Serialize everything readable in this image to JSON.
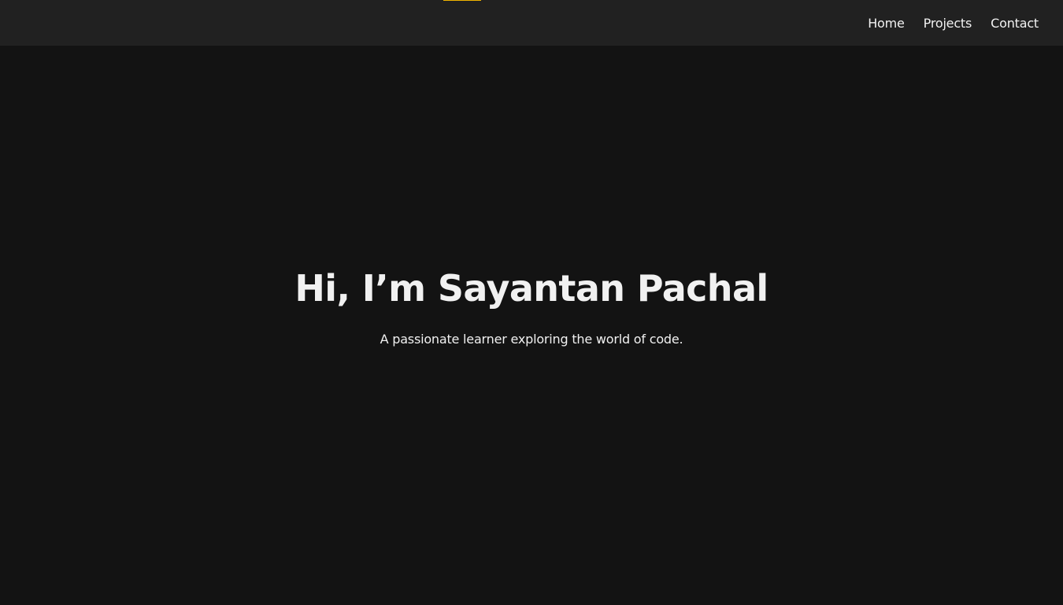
{
  "nav": {
    "links": [
      "Home",
      "Projects",
      "Contact"
    ]
  },
  "hero": {
    "title": "Hi, I’m Sayantan Pachal",
    "subtitle": "A passionate learner exploring the world of code."
  },
  "colors": {
    "page_background": "#131313",
    "navbar_background": "#212121",
    "accent": "#f0b400",
    "text": "#f1f1f1"
  }
}
